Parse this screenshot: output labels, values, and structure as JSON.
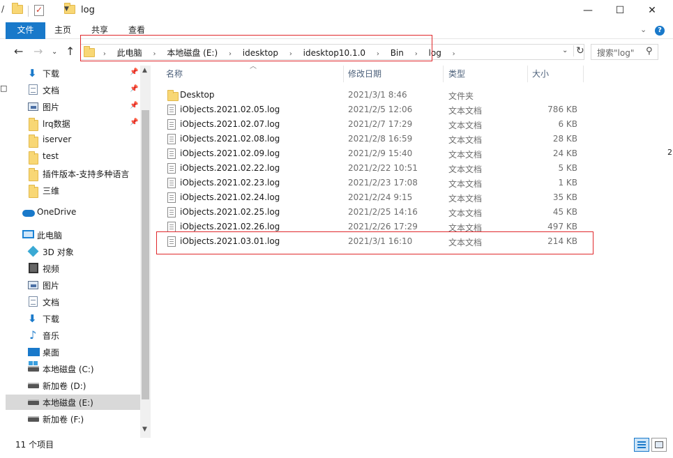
{
  "window": {
    "title": "log",
    "minimize": "—",
    "maximize": "☐",
    "close": "✕"
  },
  "ribbon": {
    "tabs": [
      "文件",
      "主页",
      "共享",
      "查看"
    ]
  },
  "address": {
    "crumbs": [
      "此电脑",
      "本地磁盘 (E:)",
      "idesktop",
      "idesktop10.1.0",
      "Bin",
      "log"
    ],
    "search_placeholder": "搜索\"log\""
  },
  "sidebar": {
    "items": [
      {
        "label": "下载",
        "icon": "download-icon",
        "pinned": true
      },
      {
        "label": "文档",
        "icon": "document-icon",
        "pinned": true
      },
      {
        "label": "图片",
        "icon": "picture-icon",
        "pinned": true
      },
      {
        "label": "lrq数据",
        "icon": "folder-icon",
        "pinned": true
      },
      {
        "label": "iserver",
        "icon": "folder-icon",
        "pinned": false
      },
      {
        "label": "test",
        "icon": "folder-icon",
        "pinned": false
      },
      {
        "label": "插件版本-支持多种语言",
        "icon": "folder-icon",
        "pinned": false
      },
      {
        "label": "三维",
        "icon": "folder-icon",
        "pinned": false
      },
      {
        "label": "OneDrive",
        "icon": "onedrive-icon",
        "pinned": false
      },
      {
        "label": "此电脑",
        "icon": "this-pc-icon",
        "pinned": false
      },
      {
        "label": "3D 对象",
        "icon": "3d-objects-icon",
        "pinned": false
      },
      {
        "label": "视频",
        "icon": "video-icon",
        "pinned": false
      },
      {
        "label": "图片",
        "icon": "picture-icon",
        "pinned": false
      },
      {
        "label": "文档",
        "icon": "document-icon",
        "pinned": false
      },
      {
        "label": "下载",
        "icon": "download-icon",
        "pinned": false
      },
      {
        "label": "音乐",
        "icon": "music-icon",
        "pinned": false
      },
      {
        "label": "桌面",
        "icon": "desktop-icon",
        "pinned": false
      },
      {
        "label": "本地磁盘 (C:)",
        "icon": "drive-c-icon",
        "pinned": false
      },
      {
        "label": "新加卷 (D:)",
        "icon": "drive-icon",
        "pinned": false
      },
      {
        "label": "本地磁盘 (E:)",
        "icon": "drive-icon",
        "pinned": false
      },
      {
        "label": "新加卷 (F:)",
        "icon": "drive-icon",
        "pinned": false
      }
    ]
  },
  "columns": [
    "名称",
    "修改日期",
    "类型",
    "大小"
  ],
  "files": [
    {
      "name": "Desktop",
      "date": "2021/3/1 8:46",
      "type": "文件夹",
      "size": "",
      "kind": "folder"
    },
    {
      "name": "iObjects.2021.02.05.log",
      "date": "2021/2/5 12:06",
      "type": "文本文档",
      "size": "786 KB",
      "kind": "doc"
    },
    {
      "name": "iObjects.2021.02.07.log",
      "date": "2021/2/7 17:29",
      "type": "文本文档",
      "size": "6 KB",
      "kind": "doc"
    },
    {
      "name": "iObjects.2021.02.08.log",
      "date": "2021/2/8 16:59",
      "type": "文本文档",
      "size": "28 KB",
      "kind": "doc"
    },
    {
      "name": "iObjects.2021.02.09.log",
      "date": "2021/2/9 15:40",
      "type": "文本文档",
      "size": "24 KB",
      "kind": "doc"
    },
    {
      "name": "iObjects.2021.02.22.log",
      "date": "2021/2/22 10:51",
      "type": "文本文档",
      "size": "5 KB",
      "kind": "doc"
    },
    {
      "name": "iObjects.2021.02.23.log",
      "date": "2021/2/23 17:08",
      "type": "文本文档",
      "size": "1 KB",
      "kind": "doc"
    },
    {
      "name": "iObjects.2021.02.24.log",
      "date": "2021/2/24 9:15",
      "type": "文本文档",
      "size": "35 KB",
      "kind": "doc"
    },
    {
      "name": "iObjects.2021.02.25.log",
      "date": "2021/2/25 14:16",
      "type": "文本文档",
      "size": "45 KB",
      "kind": "doc"
    },
    {
      "name": "iObjects.2021.02.26.log",
      "date": "2021/2/26 17:29",
      "type": "文本文档",
      "size": "497 KB",
      "kind": "doc"
    },
    {
      "name": "iObjects.2021.03.01.log",
      "date": "2021/3/1 16:10",
      "type": "文本文档",
      "size": "214 KB",
      "kind": "doc"
    }
  ],
  "status": {
    "count": "11 个项目"
  },
  "colors": {
    "accent": "#1979ca",
    "highlight_box": "#e0272b"
  }
}
